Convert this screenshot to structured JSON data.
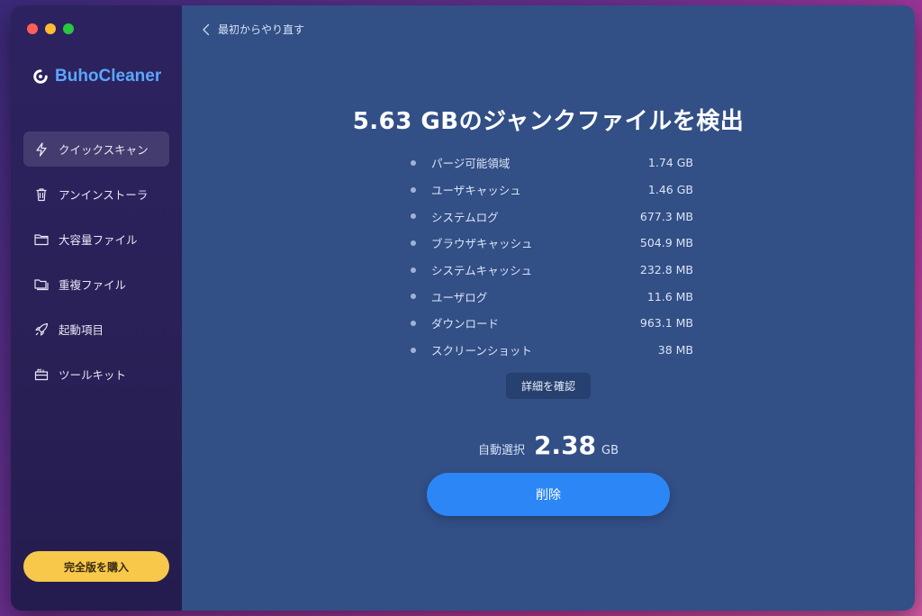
{
  "app": {
    "name": "BuhoCleaner"
  },
  "sidebar": {
    "items": [
      {
        "label": "クイックスキャン",
        "icon": "bolt-icon",
        "active": true
      },
      {
        "label": "アンインストーラ",
        "icon": "trash-icon",
        "active": false
      },
      {
        "label": "大容量ファイル",
        "icon": "folder-icon",
        "active": false
      },
      {
        "label": "重複ファイル",
        "icon": "duplicate-folder-icon",
        "active": false
      },
      {
        "label": "起動項目",
        "icon": "rocket-icon",
        "active": false
      },
      {
        "label": "ツールキット",
        "icon": "toolkit-icon",
        "active": false
      }
    ],
    "buy_label": "完全版を購入"
  },
  "main": {
    "back_label": "最初からやり直す",
    "headline": "5.63 GBのジャンクファイルを検出",
    "items": [
      {
        "name": "パージ可能領域",
        "size": "1.74 GB"
      },
      {
        "name": "ユーザキャッシュ",
        "size": "1.46 GB"
      },
      {
        "name": "システムログ",
        "size": "677.3 MB"
      },
      {
        "name": "ブラウザキャッシュ",
        "size": "504.9 MB"
      },
      {
        "name": "システムキャッシュ",
        "size": "232.8 MB"
      },
      {
        "name": "ユーザログ",
        "size": "11.6 MB"
      },
      {
        "name": "ダウンロード",
        "size": "963.1 MB"
      },
      {
        "name": "スクリーンショット",
        "size": "38 MB"
      }
    ],
    "details_label": "詳細を確認",
    "selected_label": "自動選択",
    "selected_value": "2.38",
    "selected_unit": "GB",
    "delete_label": "削除"
  },
  "colors": {
    "sidebar_bg": "#2a2158",
    "main_bg": "#324f86",
    "brand": "#5aa7ff",
    "accent": "#2c86f6",
    "buy": "#f7c84a"
  }
}
